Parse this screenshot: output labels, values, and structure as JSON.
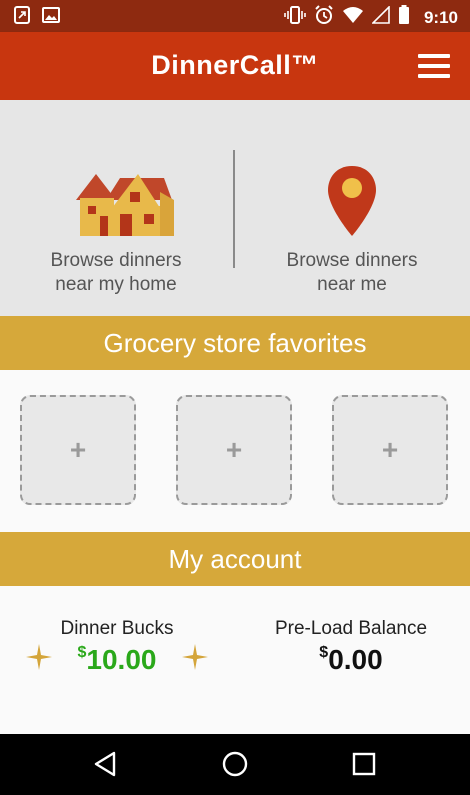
{
  "status_bar": {
    "time": "9:10",
    "left_icons": [
      "phone-screen-icon",
      "image-icon"
    ],
    "right_icons": [
      "vibrate-icon",
      "alarm-icon",
      "wifi-icon",
      "signal-icon",
      "battery-icon"
    ]
  },
  "app_bar": {
    "title": "DinnerCall™",
    "menu_icon": "hamburger-menu-icon"
  },
  "browse": {
    "home": {
      "line1": "Browse dinners",
      "line2": "near my home",
      "icon": "house-icon"
    },
    "me": {
      "line1": "Browse dinners",
      "line2": "near me",
      "icon": "location-pin-icon"
    }
  },
  "grocery": {
    "header": "Grocery store favorites",
    "slots": [
      {
        "symbol": "+"
      },
      {
        "symbol": "+"
      },
      {
        "symbol": "+"
      }
    ]
  },
  "account": {
    "header": "My account",
    "dinner_bucks": {
      "label": "Dinner Bucks",
      "currency": "$",
      "amount": "10.00"
    },
    "preload": {
      "label": "Pre-Load Balance",
      "currency": "$",
      "amount": "0.00"
    }
  },
  "colors": {
    "status_bar": "#8e2a10",
    "app_bar": "#c8360f",
    "section_header": "#d6a83a",
    "dinner_bucks_green": "#2aa81a"
  },
  "nav_bar": {
    "icons": [
      "back-icon",
      "home-icon",
      "recents-icon"
    ]
  }
}
